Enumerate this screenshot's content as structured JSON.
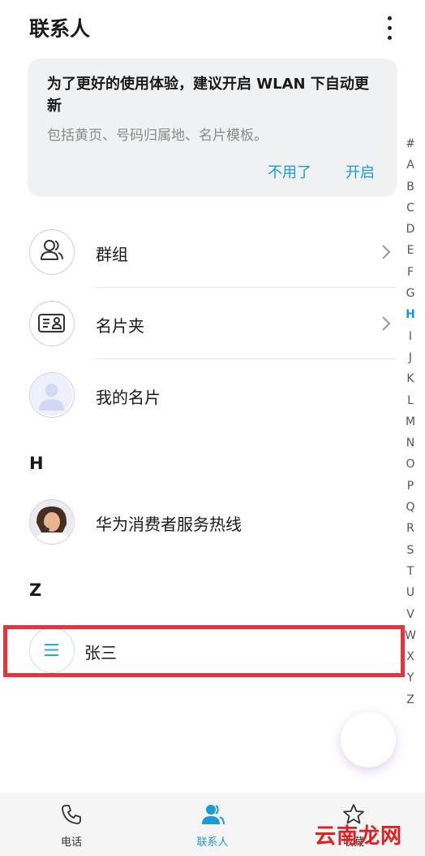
{
  "header": {
    "title": "联系人"
  },
  "banner": {
    "title": "为了更好的使用体验，建议开启 WLAN 下自动更新",
    "subtitle": "包括黄页、号码归属地、名片模板。",
    "decline_label": "不用了",
    "accept_label": "开启"
  },
  "quick_items": [
    {
      "label": "群组"
    },
    {
      "label": "名片夹"
    },
    {
      "label": "我的名片"
    }
  ],
  "sections": [
    {
      "letter": "H",
      "contacts": [
        {
          "name": "华为消费者服务热线"
        }
      ]
    },
    {
      "letter": "Z",
      "contacts": [
        {
          "name": "张三"
        }
      ]
    }
  ],
  "index_letters": [
    "#",
    "A",
    "B",
    "C",
    "D",
    "E",
    "F",
    "G",
    "H",
    "I",
    "J",
    "K",
    "L",
    "M",
    "N",
    "O",
    "P",
    "Q",
    "R",
    "S",
    "T",
    "U",
    "V",
    "W",
    "X",
    "Y",
    "Z"
  ],
  "index_active": "H",
  "bottom_nav": [
    {
      "label": "电话"
    },
    {
      "label": "联系人"
    },
    {
      "label": "收藏"
    }
  ],
  "watermark": "云南龙网",
  "colors": {
    "accent": "#1a9ad6",
    "highlight": "#e23540",
    "fab_gradient_start": "#7b61ff",
    "fab_gradient_end": "#e06cc4"
  }
}
